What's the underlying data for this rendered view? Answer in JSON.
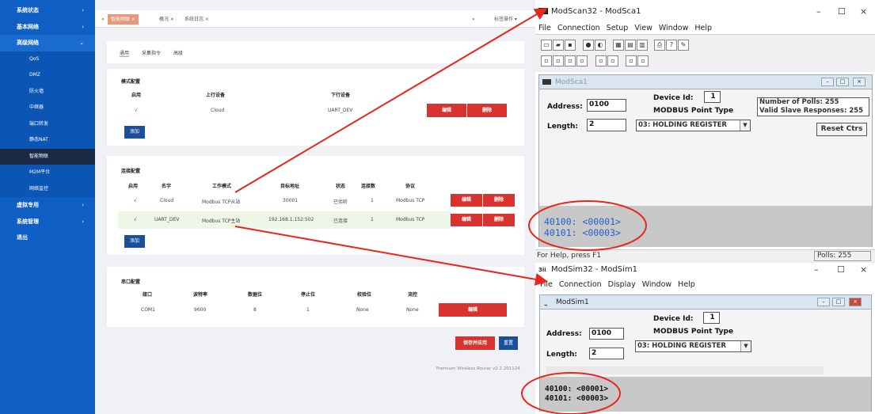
{
  "sidebar": {
    "items": [
      {
        "label": "系统状态"
      },
      {
        "label": "基本网络"
      },
      {
        "label": "高级网络"
      }
    ],
    "sub_items": [
      "QoS",
      "DMZ",
      "防火墙",
      "中继器",
      "端口转发",
      "静态NAT",
      "智能物联",
      "M2M平台",
      "网络监控"
    ],
    "bottom_items": [
      {
        "label": "虚拟专用"
      },
      {
        "label": "系统管理"
      },
      {
        "label": "退出"
      }
    ]
  },
  "tabs": {
    "nav_left": "«",
    "nav_right": "»",
    "active": "智能物联 ×",
    "overview": "概况 ×",
    "syslog": "系统日志 ×",
    "ops": "标签操作 ▾"
  },
  "inner_tabs": [
    "通用",
    "采集指令",
    "高级"
  ],
  "mode_config": {
    "title": "模式配置",
    "headers": [
      "启用",
      "上行设备",
      "下行设备"
    ],
    "row": {
      "enabled": "√",
      "up": "Cloud",
      "down": "UART_DEV"
    },
    "edit": "编辑",
    "delete": "删除",
    "add": "添加"
  },
  "conn_config": {
    "title": "连接配置",
    "headers": [
      "启用",
      "名字",
      "工作模式",
      "目标地址",
      "状态",
      "连接数",
      "协议"
    ],
    "rows": [
      {
        "enabled": "√",
        "name": "Cloud",
        "mode": "Modbus TCP从站",
        "target": "30001",
        "status": "已侦听",
        "count": "1",
        "protocol": "Modbus TCP"
      },
      {
        "enabled": "√",
        "name": "UART_DEV",
        "mode": "Modbus TCP主站",
        "target": "192.168.1.152:502",
        "status": "已连接",
        "count": "1",
        "protocol": "Modbus TCP"
      }
    ],
    "edit": "编辑",
    "delete": "删除",
    "add": "添加"
  },
  "serial_config": {
    "title": "串口配置",
    "headers": [
      "接口",
      "波特率",
      "数据位",
      "停止位",
      "校验位",
      "流控"
    ],
    "row": {
      "port": "COM1",
      "baud": "9600",
      "data": "8",
      "stop": "1",
      "parity": "None",
      "flow": "None"
    },
    "edit": "编辑"
  },
  "footer": {
    "save_apply": "保存并应用",
    "reset": "重置",
    "version": "Premium Wireless Router v2.2.201124"
  },
  "modscan": {
    "title": "ModScan32 - ModSca1",
    "menu": [
      "File",
      "Connection",
      "Setup",
      "View",
      "Window",
      "Help"
    ],
    "child_title": "ModSca1",
    "address_label": "Address:",
    "address": "0100",
    "device_id_label": "Device Id:",
    "device_id": "1",
    "point_type_label": "MODBUS Point Type",
    "length_label": "Length:",
    "length": "2",
    "point_type": "03: HOLDING REGISTER",
    "polls": "Number of Polls: 255",
    "valid": "Valid Slave Responses: 255",
    "reset": "Reset Ctrs",
    "values": [
      "40100:  <00001>",
      "40101:  <00003>"
    ],
    "status_help": "For Help, press F1",
    "status_polls": "Polls: 255"
  },
  "modsim": {
    "title": "ModSim32 - ModSim1",
    "menu": [
      "File",
      "Connection",
      "Display",
      "Window",
      "Help"
    ],
    "child_title": "ModSim1",
    "address_label": "Address:",
    "address": "0100",
    "device_id_label": "Device Id:",
    "device_id": "1",
    "point_type_label": "MODBUS Point Type",
    "length_label": "Length:",
    "length": "2",
    "point_type": "03: HOLDING REGISTER",
    "values": [
      "40100: <00001>",
      "40101: <00003>"
    ]
  },
  "colors": {
    "sidebar": "#0f5ec3",
    "accent_red": "#d8332f",
    "annotation": "#e8261c",
    "modscan_value": "#1e63c9"
  }
}
